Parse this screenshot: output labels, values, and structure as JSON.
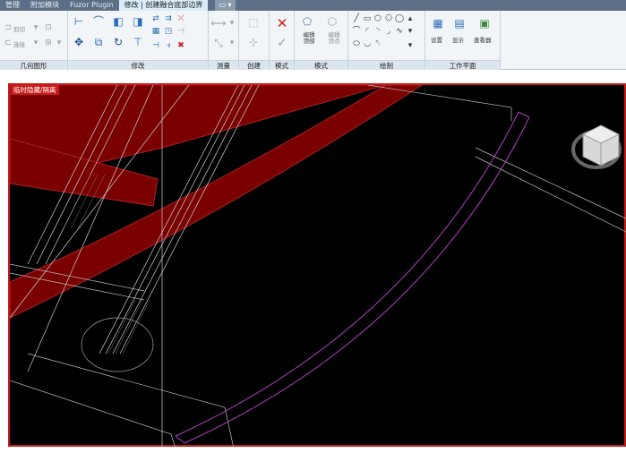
{
  "ribbon_tabs": [
    {
      "label": "管理"
    },
    {
      "label": "附加模块"
    },
    {
      "label": "Fuzor Plugin"
    },
    {
      "label": "修改 | 创建融合底部边界"
    },
    {
      "label": "▭ ▾"
    }
  ],
  "panels": {
    "geometry": {
      "label": "几何图形",
      "cut": "剪切",
      "join": "连接"
    },
    "modify": {
      "label": "修改"
    },
    "measure": {
      "label": "测量"
    },
    "create": {
      "label": "创建"
    },
    "mode": {
      "label": "模式"
    },
    "blend_mode": {
      "label": "模式",
      "edit_top": "编辑\n顶部",
      "edit_vertex": "编辑\n顶点"
    },
    "draw": {
      "label": "绘制"
    },
    "workplane": {
      "label": "工作平面",
      "set": "设置",
      "show": "显示",
      "viewer": "查看器"
    }
  },
  "viewport": {
    "badge": "临时隐藏/隔离"
  },
  "colors": {
    "tabbar": "#5b6f86",
    "ribbon_bg": "#f1f5f8",
    "viewport_bg": "#000000",
    "isolate_border": "#c81c1c",
    "red_fill": "#7a0000",
    "sketch_magenta": "#b040c0"
  },
  "icons": {
    "cancel": "x-icon",
    "finish": "checkmark-icon",
    "viewcube": "viewcube-icon"
  }
}
